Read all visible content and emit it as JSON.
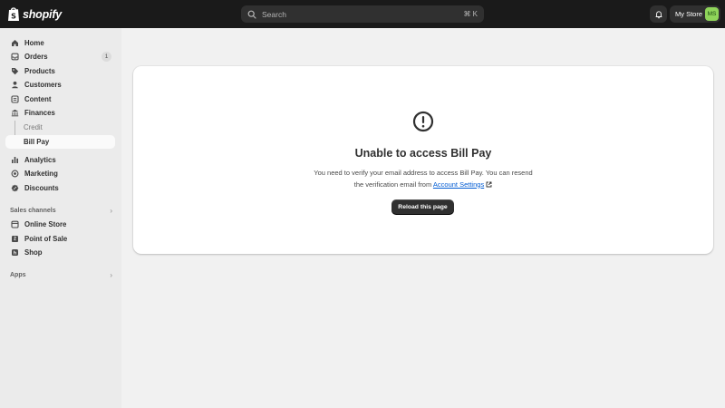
{
  "header": {
    "logo_text": "shopify",
    "search_placeholder": "Search",
    "search_shortcut": "⌘ K",
    "store_name": "My Store",
    "store_initials": "MS"
  },
  "sidebar": {
    "items": [
      {
        "label": "Home",
        "icon": "home-icon"
      },
      {
        "label": "Orders",
        "icon": "orders-icon",
        "badge": "1"
      },
      {
        "label": "Products",
        "icon": "tag-icon"
      },
      {
        "label": "Customers",
        "icon": "person-icon"
      },
      {
        "label": "Content",
        "icon": "content-icon"
      },
      {
        "label": "Finances",
        "icon": "bank-icon"
      },
      {
        "label": "Analytics",
        "icon": "bar-chart-icon"
      },
      {
        "label": "Marketing",
        "icon": "target-icon"
      },
      {
        "label": "Discounts",
        "icon": "discount-icon"
      }
    ],
    "finance_subitems": [
      "Credit",
      "Bill Pay"
    ],
    "sales_channels_label": "Sales channels",
    "channels": [
      {
        "label": "Online Store",
        "icon": "store-icon"
      },
      {
        "label": "Point of Sale",
        "icon": "pos-icon"
      },
      {
        "label": "Shop",
        "icon": "shop-icon"
      }
    ],
    "apps_label": "Apps"
  },
  "main": {
    "title": "Unable to access Bill Pay",
    "body_line1": "You need to verify your email address to access Bill Pay. You can resend",
    "body_line2_prefix": "the verification email from ",
    "link_text": "Account Settings",
    "button_label": "Reload this page"
  },
  "colors": {
    "topbar": "#1a1a1a",
    "sidebar": "#ebebeb",
    "page": "#f1f1f1",
    "link": "#005bd3",
    "avatar": "#8fd45a",
    "button": "#303030"
  }
}
